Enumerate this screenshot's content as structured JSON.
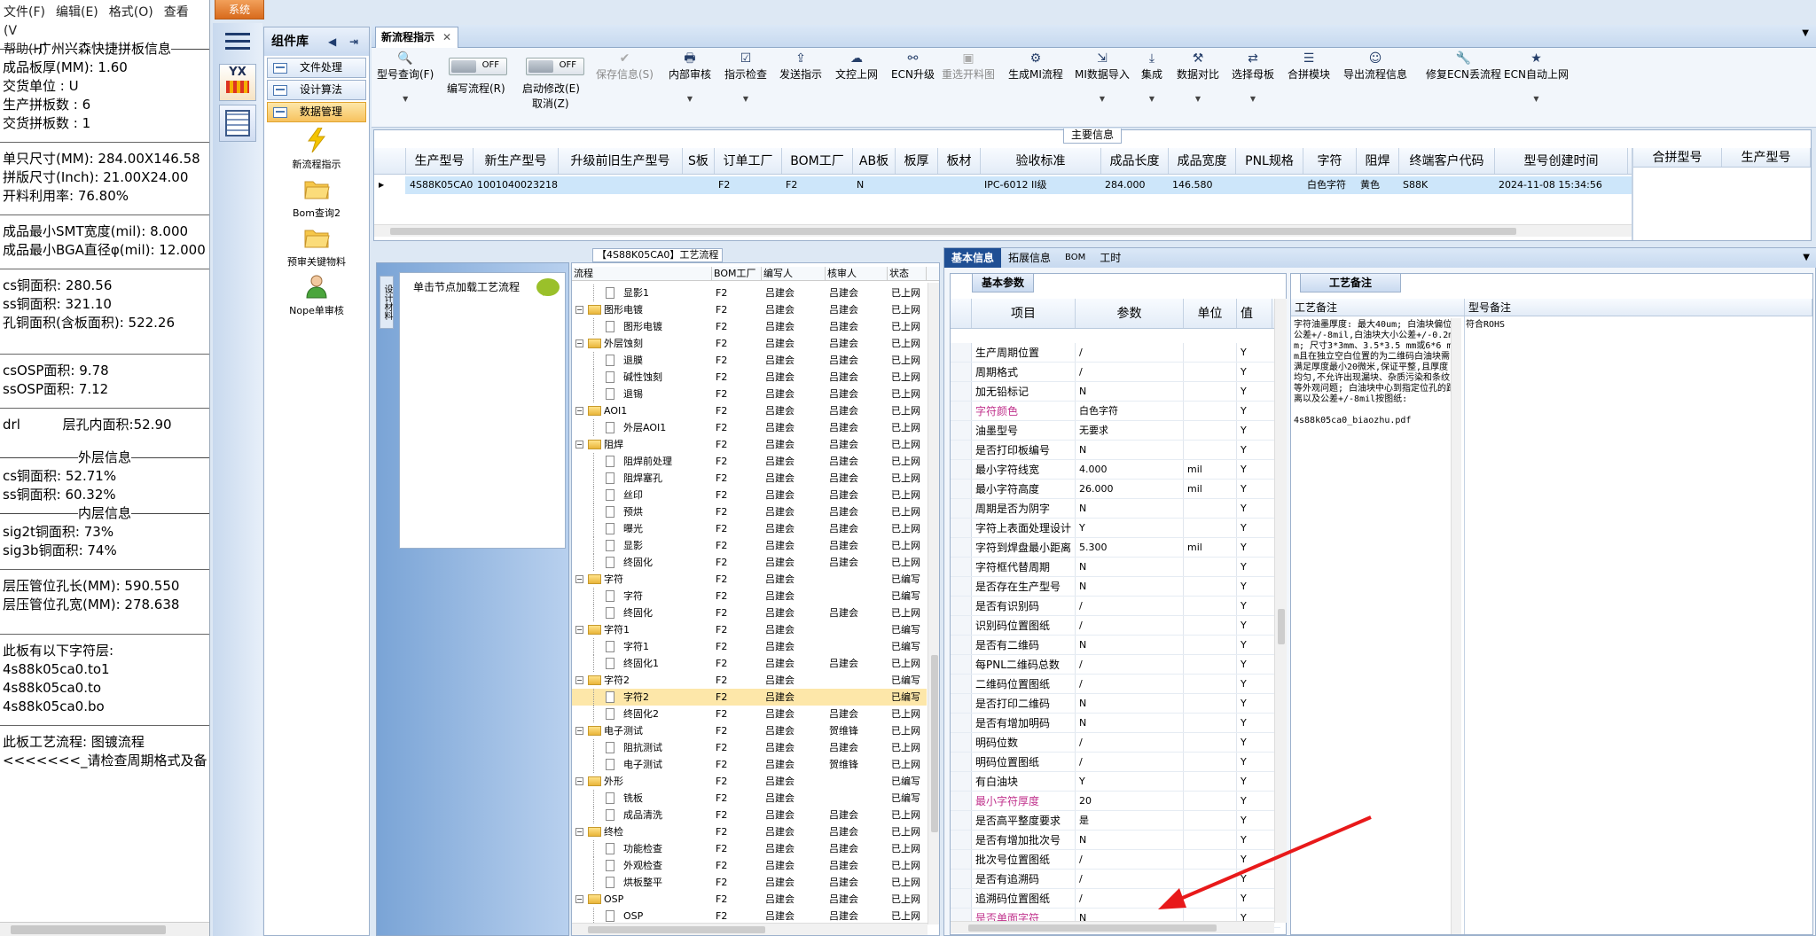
{
  "left_panel": {
    "menu": [
      "文件(F)",
      "编辑(E)",
      "格式(O)",
      "查看(V",
      "帮助(H)"
    ],
    "company_header": "广州兴森快捷拼板信息",
    "lines_1": [
      "成品板厚(MM): 1.60",
      "交货单位 : U",
      "生产拼板数 : 6",
      "交货拼板数 : 1"
    ],
    "lines_2": [
      "单只尺寸(MM): 284.00X146.58",
      "拼版尺寸(Inch): 21.00X24.00",
      "开料利用率: 76.80%"
    ],
    "lines_3": [
      "成品最小SMT宽度(mil): 8.000",
      "成品最小BGA直径φ(mil):  12.000"
    ],
    "lines_4": [
      "cs铜面积: 280.56",
      "ss铜面积: 321.10",
      "孔铜面积(含板面积): 522.26"
    ],
    "lines_5": [
      "csOSP面积: 9.78",
      "ssOSP面积: 7.12"
    ],
    "drl_line": "drl          层孔内面积:52.90",
    "outer_header": "外层信息",
    "outer_lines": [
      "cs铜面积: 52.71%",
      "ss铜面积: 60.32%"
    ],
    "inner_header": "内层信息",
    "inner_lines": [
      "sig2t铜面积: 73%",
      "sig3b铜面积: 74%"
    ],
    "press_lines": [
      "层压管位孔长(MM): 590.550",
      "层压管位孔宽(MM): 278.638"
    ],
    "char_layers_title": "此板有以下字符层:",
    "char_layers": [
      "4s88k05ca0.to1",
      "4s88k05ca0.to",
      "4s88k05ca0.bo"
    ],
    "flow_line": "此板工艺流程: 图镀流程",
    "warn_line": "<<<<<<<_请检查周期格式及备"
  },
  "system_button": "系统",
  "app_icon_text": "YX",
  "component_lib": {
    "title": "组件库",
    "tabs": [
      "文件处理",
      "设计算法",
      "数据管理"
    ],
    "items": [
      "新流程指示",
      "Bom查询2",
      "预审关键物料",
      "Nope单审核"
    ]
  },
  "doc_tab": "新流程指示",
  "ribbon": {
    "b0": "型号查询(F)",
    "toggle1_label": "编写流程(R)",
    "toggle2_label": "启动修改(E)",
    "toggle2_sub": "取消(Z)",
    "toggle_off": "OFF",
    "b1": "保存信息(S)",
    "b2": "内部审核",
    "b3": "指示检查",
    "b4": "发送指示",
    "b5": "文控上网",
    "b6": "ECN升级",
    "b7": "重选开料图",
    "b8": "生成MI流程",
    "b9": "MI数据导入",
    "b10": "集成",
    "b11": "数据对比",
    "b12": "选择母板",
    "b13": "合拼模块",
    "b14": "导出流程信息",
    "b15": "修复ECN丢流程",
    "b16": "ECN自动上网"
  },
  "main_info": {
    "title": "主要信息",
    "columns": [
      "生产型号",
      "新生产型号",
      "升级前旧生产型号",
      "S板",
      "订单工厂",
      "BOM工厂",
      "AB板",
      "板厚",
      "板材",
      "验收标准",
      "成品长度",
      "成品宽度",
      "PNL规格",
      "字符",
      "阻焊",
      "终端客户代码",
      "型号创建时间"
    ],
    "row": [
      "4S88K05CA0",
      "10010400232181",
      "",
      "",
      "F2",
      "F2",
      "N",
      "",
      "",
      "IPC-6012 II级",
      "284.000",
      "146.580",
      "",
      "白色字符",
      "黄色",
      "S88K",
      "2024-11-08 15:34:56"
    ],
    "side_columns": [
      "合拼型号",
      "生产型号"
    ]
  },
  "flow_panel": {
    "title": "【4S88K05CA0】工艺流程",
    "vert_tab": "设计材料",
    "click_hint": "单击节点加载工艺流程",
    "tree_columns": [
      "流程",
      "BOM工厂",
      "编写人",
      "核审人",
      "状态"
    ],
    "rows": [
      {
        "name": "显影1",
        "f": "F2",
        "w": "吕建会",
        "r": "吕建会",
        "s": "已上网",
        "lvl": 2
      },
      {
        "name": "图形电镀",
        "f": "F2",
        "w": "吕建会",
        "r": "吕建会",
        "s": "已上网",
        "lvl": 1
      },
      {
        "name": "图形电镀",
        "f": "F2",
        "w": "吕建会",
        "r": "吕建会",
        "s": "已上网",
        "lvl": 2
      },
      {
        "name": "外层蚀刻",
        "f": "F2",
        "w": "吕建会",
        "r": "吕建会",
        "s": "已上网",
        "lvl": 1
      },
      {
        "name": "退膜",
        "f": "F2",
        "w": "吕建会",
        "r": "吕建会",
        "s": "已上网",
        "lvl": 2
      },
      {
        "name": "碱性蚀刻",
        "f": "F2",
        "w": "吕建会",
        "r": "吕建会",
        "s": "已上网",
        "lvl": 2
      },
      {
        "name": "退锡",
        "f": "F2",
        "w": "吕建会",
        "r": "吕建会",
        "s": "已上网",
        "lvl": 2
      },
      {
        "name": "AOI1",
        "f": "F2",
        "w": "吕建会",
        "r": "吕建会",
        "s": "已上网",
        "lvl": 1
      },
      {
        "name": "外层AOI1",
        "f": "F2",
        "w": "吕建会",
        "r": "吕建会",
        "s": "已上网",
        "lvl": 2
      },
      {
        "name": "阻焊",
        "f": "F2",
        "w": "吕建会",
        "r": "吕建会",
        "s": "已上网",
        "lvl": 1
      },
      {
        "name": "阻焊前处理",
        "f": "F2",
        "w": "吕建会",
        "r": "吕建会",
        "s": "已上网",
        "lvl": 2
      },
      {
        "name": "阻焊塞孔",
        "f": "F2",
        "w": "吕建会",
        "r": "吕建会",
        "s": "已上网",
        "lvl": 2
      },
      {
        "name": "丝印",
        "f": "F2",
        "w": "吕建会",
        "r": "吕建会",
        "s": "已上网",
        "lvl": 2
      },
      {
        "name": "预烘",
        "f": "F2",
        "w": "吕建会",
        "r": "吕建会",
        "s": "已上网",
        "lvl": 2
      },
      {
        "name": "曝光",
        "f": "F2",
        "w": "吕建会",
        "r": "吕建会",
        "s": "已上网",
        "lvl": 2
      },
      {
        "name": "显影",
        "f": "F2",
        "w": "吕建会",
        "r": "吕建会",
        "s": "已上网",
        "lvl": 2
      },
      {
        "name": "终固化",
        "f": "F2",
        "w": "吕建会",
        "r": "吕建会",
        "s": "已上网",
        "lvl": 2
      },
      {
        "name": "字符",
        "f": "F2",
        "w": "吕建会",
        "r": "",
        "s": "已编写",
        "lvl": 1
      },
      {
        "name": "字符",
        "f": "F2",
        "w": "吕建会",
        "r": "",
        "s": "已编写",
        "lvl": 2
      },
      {
        "name": "终固化",
        "f": "F2",
        "w": "吕建会",
        "r": "吕建会",
        "s": "已上网",
        "lvl": 2
      },
      {
        "name": "字符1",
        "f": "F2",
        "w": "吕建会",
        "r": "",
        "s": "已编写",
        "lvl": 1
      },
      {
        "name": "字符1",
        "f": "F2",
        "w": "吕建会",
        "r": "",
        "s": "已编写",
        "lvl": 2
      },
      {
        "name": "终固化1",
        "f": "F2",
        "w": "吕建会",
        "r": "吕建会",
        "s": "已上网",
        "lvl": 2
      },
      {
        "name": "字符2",
        "f": "F2",
        "w": "吕建会",
        "r": "",
        "s": "已编写",
        "lvl": 1
      },
      {
        "name": "字符2",
        "f": "F2",
        "w": "吕建会",
        "r": "",
        "s": "已编写",
        "lvl": 2,
        "sel": true
      },
      {
        "name": "终固化2",
        "f": "F2",
        "w": "吕建会",
        "r": "吕建会",
        "s": "已上网",
        "lvl": 2
      },
      {
        "name": "电子测试",
        "f": "F2",
        "w": "吕建会",
        "r": "贺维锋",
        "s": "已上网",
        "lvl": 1
      },
      {
        "name": "阻抗测试",
        "f": "F2",
        "w": "吕建会",
        "r": "吕建会",
        "s": "已上网",
        "lvl": 2
      },
      {
        "name": "电子测试",
        "f": "F2",
        "w": "吕建会",
        "r": "贺维锋",
        "s": "已上网",
        "lvl": 2
      },
      {
        "name": "外形",
        "f": "F2",
        "w": "吕建会",
        "r": "",
        "s": "已编写",
        "lvl": 1
      },
      {
        "name": "铣板",
        "f": "F2",
        "w": "吕建会",
        "r": "",
        "s": "已编写",
        "lvl": 2
      },
      {
        "name": "成品清洗",
        "f": "F2",
        "w": "吕建会",
        "r": "吕建会",
        "s": "已上网",
        "lvl": 2
      },
      {
        "name": "终检",
        "f": "F2",
        "w": "吕建会",
        "r": "吕建会",
        "s": "已上网",
        "lvl": 1
      },
      {
        "name": "功能检查",
        "f": "F2",
        "w": "吕建会",
        "r": "吕建会",
        "s": "已上网",
        "lvl": 2
      },
      {
        "name": "外观检查",
        "f": "F2",
        "w": "吕建会",
        "r": "吕建会",
        "s": "已上网",
        "lvl": 2
      },
      {
        "name": "烘板整平",
        "f": "F2",
        "w": "吕建会",
        "r": "吕建会",
        "s": "已上网",
        "lvl": 2
      },
      {
        "name": "OSP",
        "f": "F2",
        "w": "吕建会",
        "r": "吕建会",
        "s": "已上网",
        "lvl": 1
      },
      {
        "name": "OSP",
        "f": "F2",
        "w": "吕建会",
        "r": "吕建会",
        "s": "已上网",
        "lvl": 2
      }
    ]
  },
  "right_tabs": [
    "基本信息",
    "拓展信息",
    "BOM",
    "工时"
  ],
  "basic_params": {
    "title": "基本参数",
    "columns": [
      "项目",
      "参数",
      "单位",
      "值"
    ],
    "rows": [
      {
        "item": "生产周期位置",
        "val": "/",
        "unit": "",
        "flag": "Y"
      },
      {
        "item": "周期格式",
        "val": "/",
        "unit": "",
        "flag": "Y"
      },
      {
        "item": "加无铅标记",
        "val": "N",
        "unit": "",
        "flag": "Y"
      },
      {
        "item": "字符颜色",
        "val": "白色字符",
        "unit": "",
        "flag": "Y",
        "pink": true
      },
      {
        "item": "油墨型号",
        "val": "无要求",
        "unit": "",
        "flag": "Y"
      },
      {
        "item": "是否打印板编号",
        "val": "N",
        "unit": "",
        "flag": "Y"
      },
      {
        "item": "最小字符线宽",
        "val": "4.000",
        "unit": "mil",
        "flag": "Y"
      },
      {
        "item": "最小字符高度",
        "val": "26.000",
        "unit": "mil",
        "flag": "Y"
      },
      {
        "item": "周期是否为阴字",
        "val": "N",
        "unit": "",
        "flag": "Y"
      },
      {
        "item": "字符上表面处理设计",
        "val": "Y",
        "unit": "",
        "flag": "Y"
      },
      {
        "item": "字符到焊盘最小距离",
        "val": "5.300",
        "unit": "mil",
        "flag": "Y"
      },
      {
        "item": "字符框代替周期",
        "val": "N",
        "unit": "",
        "flag": "Y"
      },
      {
        "item": "是否存在生产型号",
        "val": "N",
        "unit": "",
        "flag": "Y"
      },
      {
        "item": "是否有识别码",
        "val": "/",
        "unit": "",
        "flag": "Y"
      },
      {
        "item": "识别码位置图纸",
        "val": "/",
        "unit": "",
        "flag": "Y"
      },
      {
        "item": "是否有二维码",
        "val": "N",
        "unit": "",
        "flag": "Y"
      },
      {
        "item": "每PNL二维码总数",
        "val": "/",
        "unit": "",
        "flag": "Y"
      },
      {
        "item": "二维码位置图纸",
        "val": "/",
        "unit": "",
        "flag": "Y"
      },
      {
        "item": "是否打印二维码",
        "val": "N",
        "unit": "",
        "flag": "Y"
      },
      {
        "item": "是否有增加明码",
        "val": "N",
        "unit": "",
        "flag": "Y"
      },
      {
        "item": "明码位数",
        "val": "/",
        "unit": "",
        "flag": "Y"
      },
      {
        "item": "明码位置图纸",
        "val": "/",
        "unit": "",
        "flag": "Y"
      },
      {
        "item": "有白油块",
        "val": "Y",
        "unit": "",
        "flag": "Y"
      },
      {
        "item": "最小字符厚度",
        "val": "20",
        "unit": "",
        "flag": "Y",
        "pink": true
      },
      {
        "item": "是否高平整度要求",
        "val": "是",
        "unit": "",
        "flag": "Y"
      },
      {
        "item": "是否有增加批次号",
        "val": "N",
        "unit": "",
        "flag": "Y"
      },
      {
        "item": "批次号位置图纸",
        "val": "/",
        "unit": "",
        "flag": "Y"
      },
      {
        "item": "是否有追溯码",
        "val": "/",
        "unit": "",
        "flag": "Y"
      },
      {
        "item": "追溯码位置图纸",
        "val": "/",
        "unit": "",
        "flag": "Y"
      },
      {
        "item": "是否单面字符",
        "val": "N",
        "unit": "",
        "flag": "Y",
        "pink": true
      }
    ]
  },
  "process_notes": {
    "title": "工艺备注",
    "columns": [
      "工艺备注",
      "型号备注"
    ],
    "note_text": "字符油墨厚度: 最大40um; 白油块偏位公差+/-8mil,白油块大小公差+/-0.2mm; 尺寸3*3mm、3.5*3.5 mm或6*6 mm且在独立空白位置的为二维码白油块需满足厚度最小20微米,保证平整,且厚度均匀,不允许出现漏块、杂质污染和条纹等外观问题; 白油块中心到指定位孔的距离以及公差+/-8mil按图纸:",
    "note_file": "4s88k05ca0_biaozhu.pdf",
    "model_note": "符合ROHS"
  },
  "colors": {
    "accent": "#1f4f94",
    "highlight": "#fde7a9",
    "row_select": "#cde6fa",
    "pink_label": "#c0328c",
    "arrow": "#e8191a"
  }
}
